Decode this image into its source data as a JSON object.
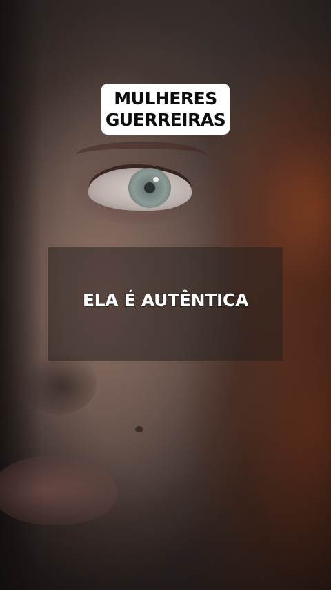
{
  "badge": {
    "line1": "MULHERES",
    "line2": "GUERREIRAS",
    "background_color": "#ffffff",
    "text_color": "#0d0d0d"
  },
  "caption": {
    "text": "ELA É AUTÊNTICA",
    "text_color": "#ffffff"
  },
  "background": {
    "image": "close-up portrait of a woman with red hair"
  }
}
